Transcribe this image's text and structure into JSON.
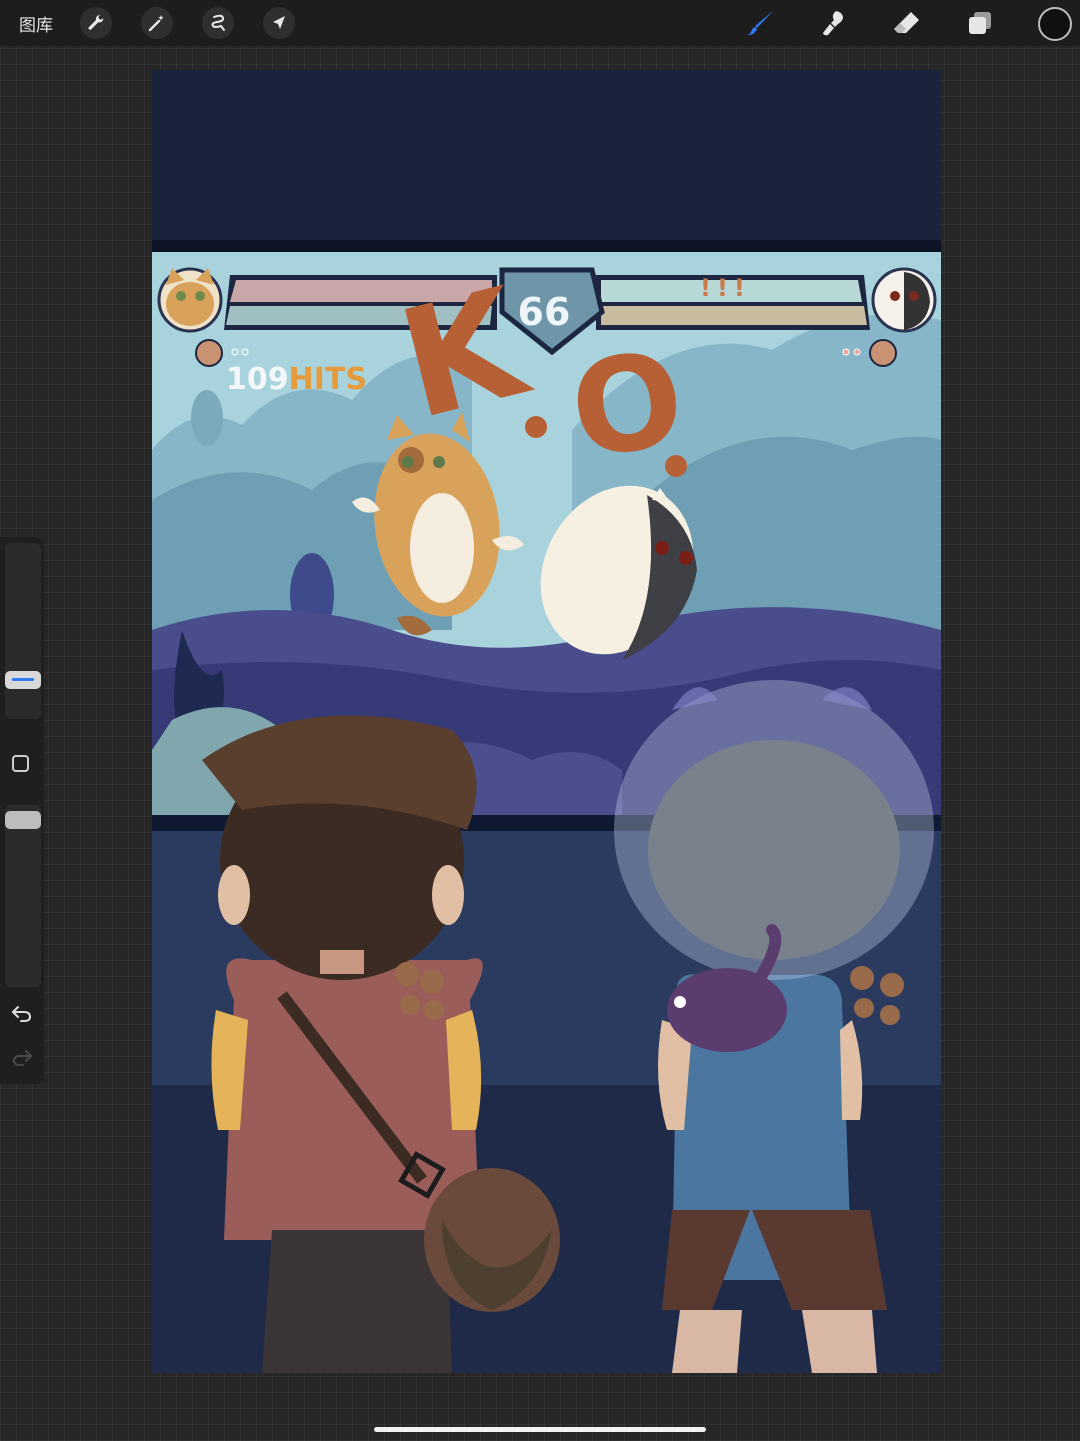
{
  "topbar": {
    "gallery_label": "图库",
    "left_tools": [
      "wrench-icon",
      "magic-wand-icon",
      "selection-icon",
      "transform-arrow-icon"
    ],
    "right_tools": [
      "brush-icon",
      "smudge-icon",
      "eraser-icon",
      "layers-icon",
      "color-well"
    ],
    "colors": {
      "bar": "#1d1d1d",
      "active_tool": "#2f7bf6",
      "color_well": "#111111"
    }
  },
  "sidebar": {
    "tools": [
      "brush-size-slider",
      "modify-button",
      "opacity-slider",
      "undo-icon",
      "redo-icon"
    ]
  },
  "canvas": {
    "hud": {
      "timer": "66",
      "combo_count": "109",
      "combo_word": "HITS",
      "opponent_status": "!!!",
      "ko_text_k": "K",
      "ko_text_o": "O"
    },
    "colors": {
      "sky_top": "#1a233c",
      "scene_sky": "#a9d3dc",
      "ground": "#2b3b60",
      "ko": "#b86035",
      "hits": "#e59a3c"
    }
  }
}
